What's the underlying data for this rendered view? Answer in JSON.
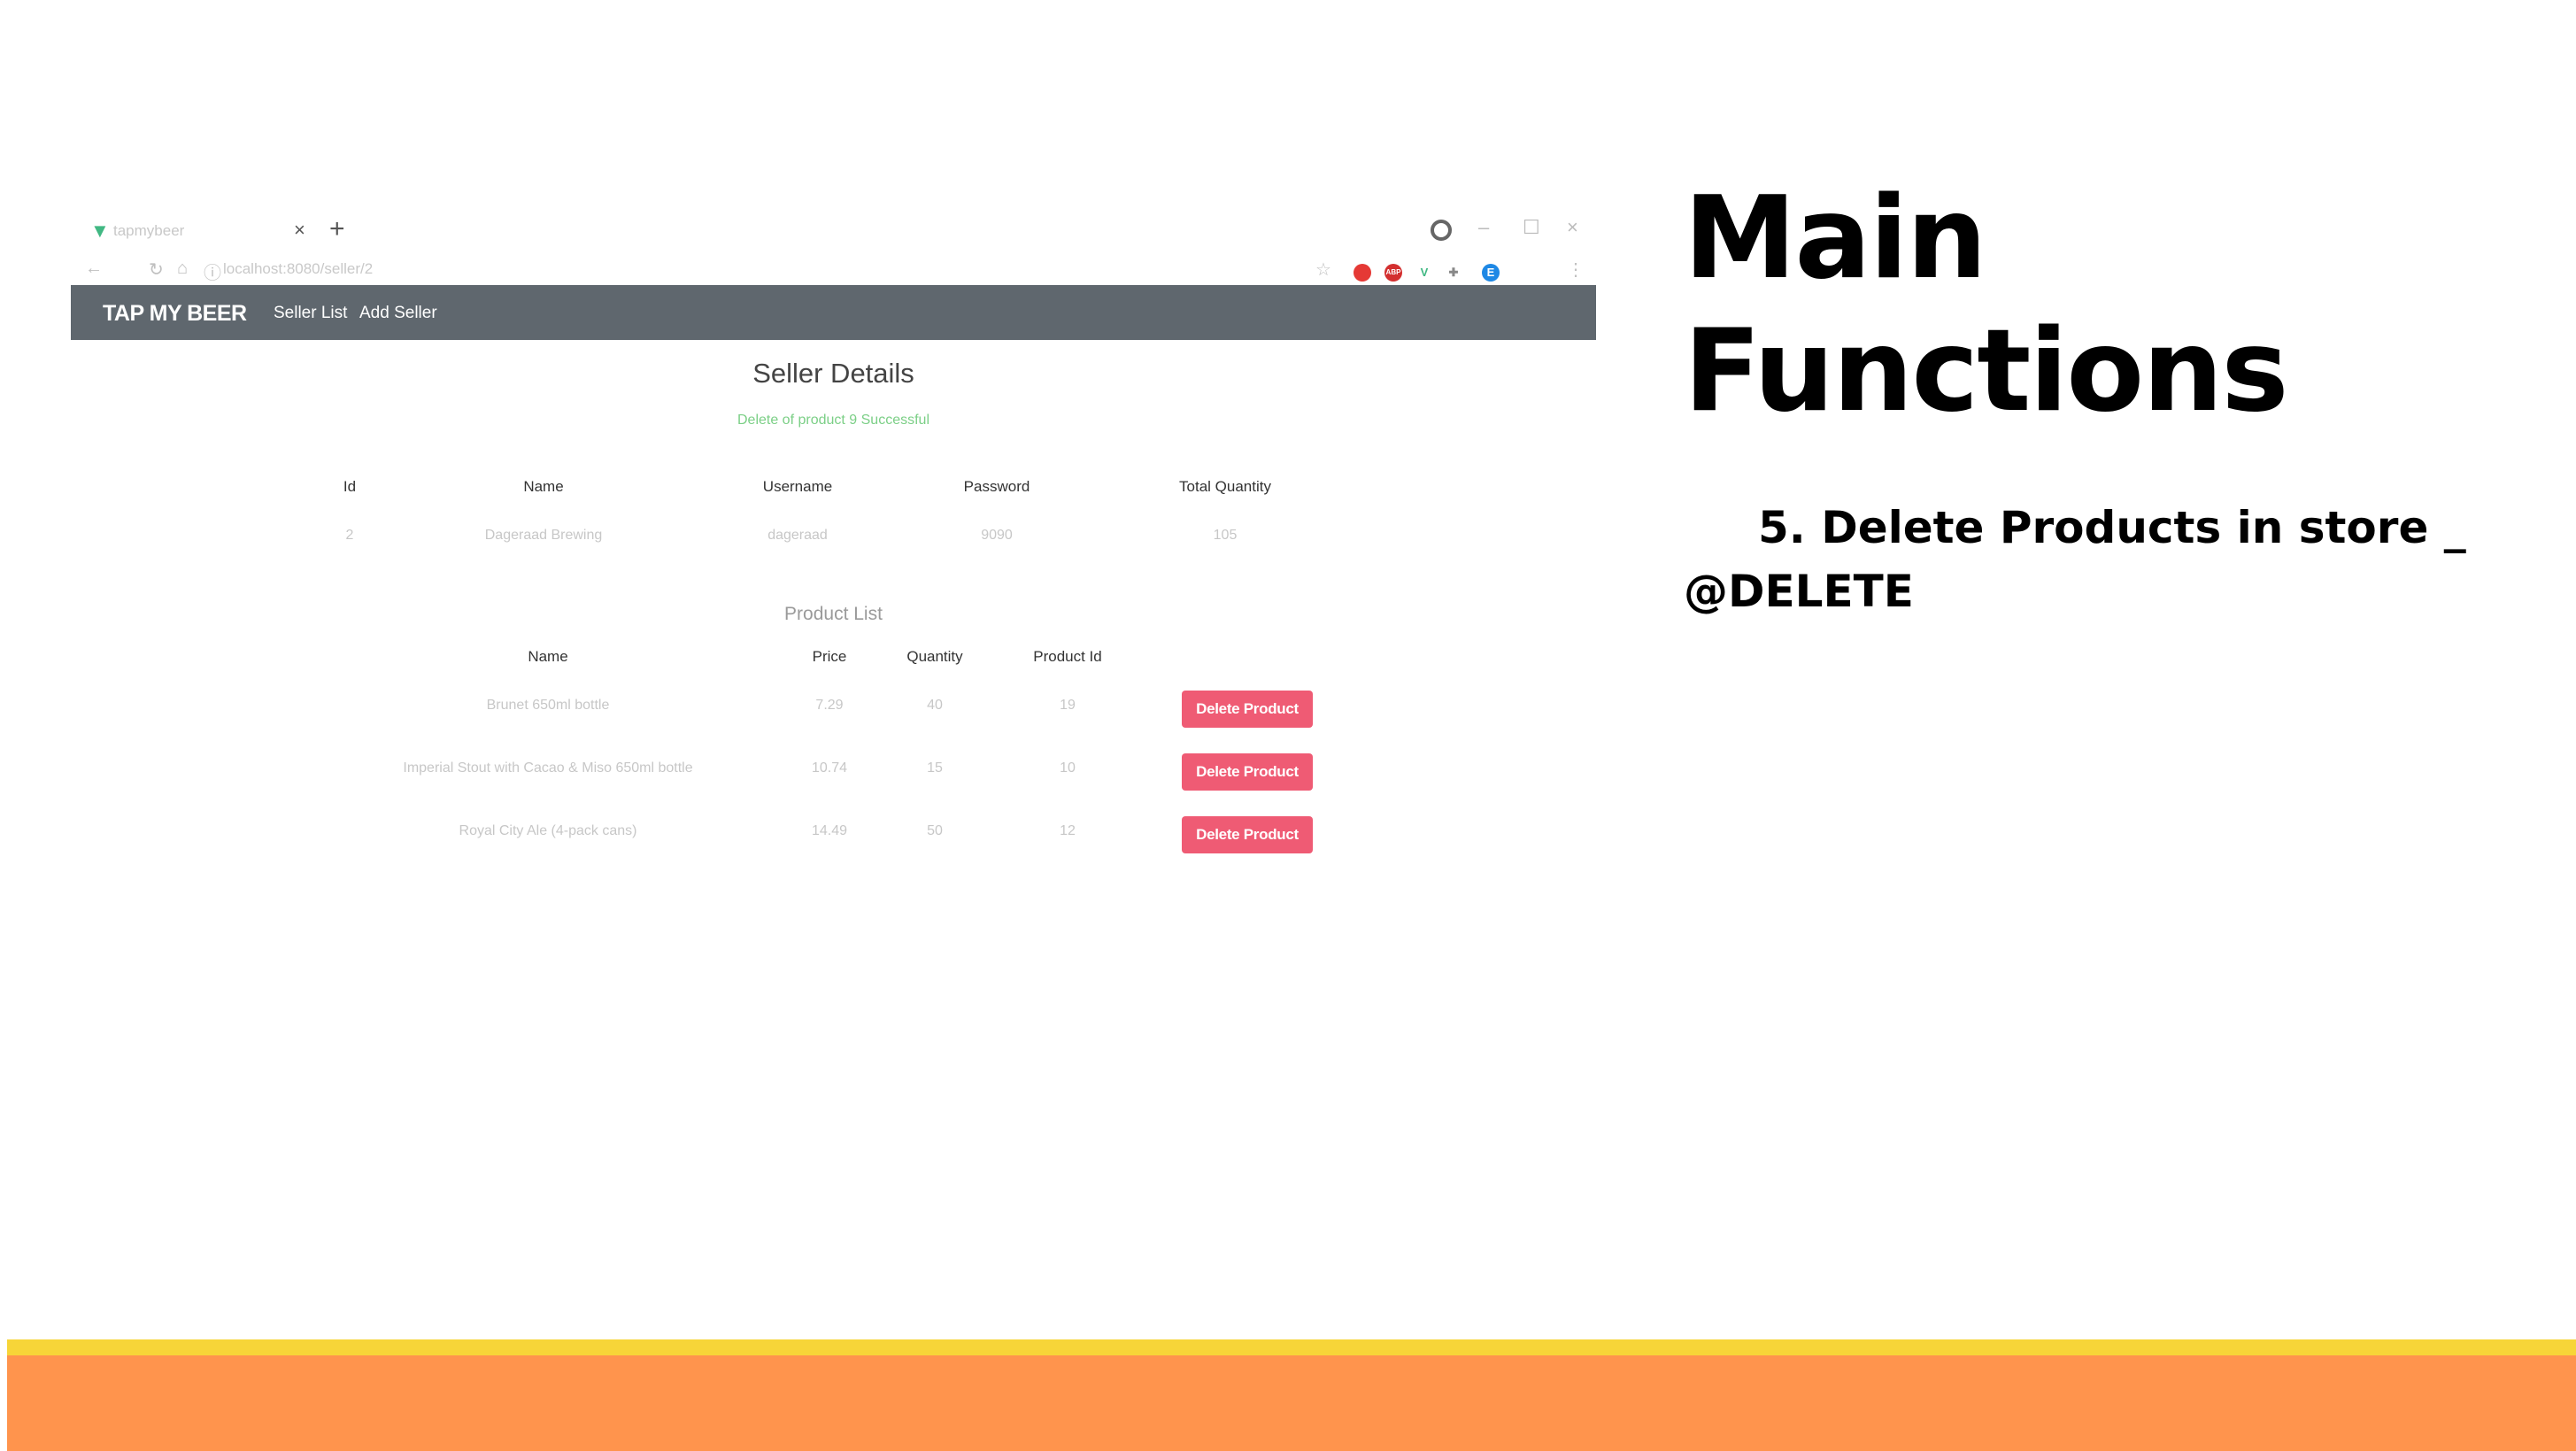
{
  "slide": {
    "title_line1": "Main",
    "title_line2": "Functions",
    "bullet_line1": "5. Delete Products in store _",
    "bullet_line2": "@DELETE"
  },
  "browser": {
    "tab": {
      "title": "tapmybeer",
      "close_glyph": "×",
      "new_tab_glyph": "+",
      "favicon": "vue-logo-icon"
    },
    "window_controls": [
      "–",
      "☐",
      "×"
    ],
    "url": "localhost:8080/seller/2",
    "extensions": [
      {
        "name": "red-ext-icon",
        "color": "#e53935",
        "glyph": ""
      },
      {
        "name": "abp-ext-icon",
        "color": "#d32f2f",
        "glyph": "ABP"
      },
      {
        "name": "vue-devtools-icon",
        "color": "#41b883",
        "glyph": "V"
      },
      {
        "name": "puzzle-ext-icon",
        "color": "#888888",
        "glyph": ""
      },
      {
        "name": "profile-avatar-icon",
        "color": "#1e88e5",
        "glyph": "E"
      }
    ]
  },
  "navbar": {
    "brand": "TAP MY BEER",
    "links": [
      "Seller List",
      "Add Seller"
    ],
    "bg": "#5f676e"
  },
  "seller": {
    "title": "Seller Details",
    "alert": "Delete of product 9 Successful",
    "headers": [
      "Id",
      "Name",
      "Username",
      "Password",
      "Total Quantity"
    ],
    "row": [
      "2",
      "Dageraad Brewing",
      "dageraad",
      "9090",
      "105"
    ]
  },
  "products": {
    "title": "Product List",
    "headers": [
      "Name",
      "Price",
      "Quantity",
      "Product Id"
    ],
    "rows": [
      {
        "name": "Brunet 650ml bottle",
        "price": "7.29",
        "quantity": "40",
        "id": "19"
      },
      {
        "name": "Imperial Stout with Cacao & Miso 650ml bottle",
        "price": "10.74",
        "quantity": "15",
        "id": "10"
      },
      {
        "name": "Royal City Ale (4-pack cans)",
        "price": "14.49",
        "quantity": "50",
        "id": "12"
      }
    ],
    "delete_label": "Delete Product",
    "delete_color": "#ef5b74"
  },
  "footer_colors": {
    "yellow": "#f7d538",
    "orange": "#ff944d"
  }
}
